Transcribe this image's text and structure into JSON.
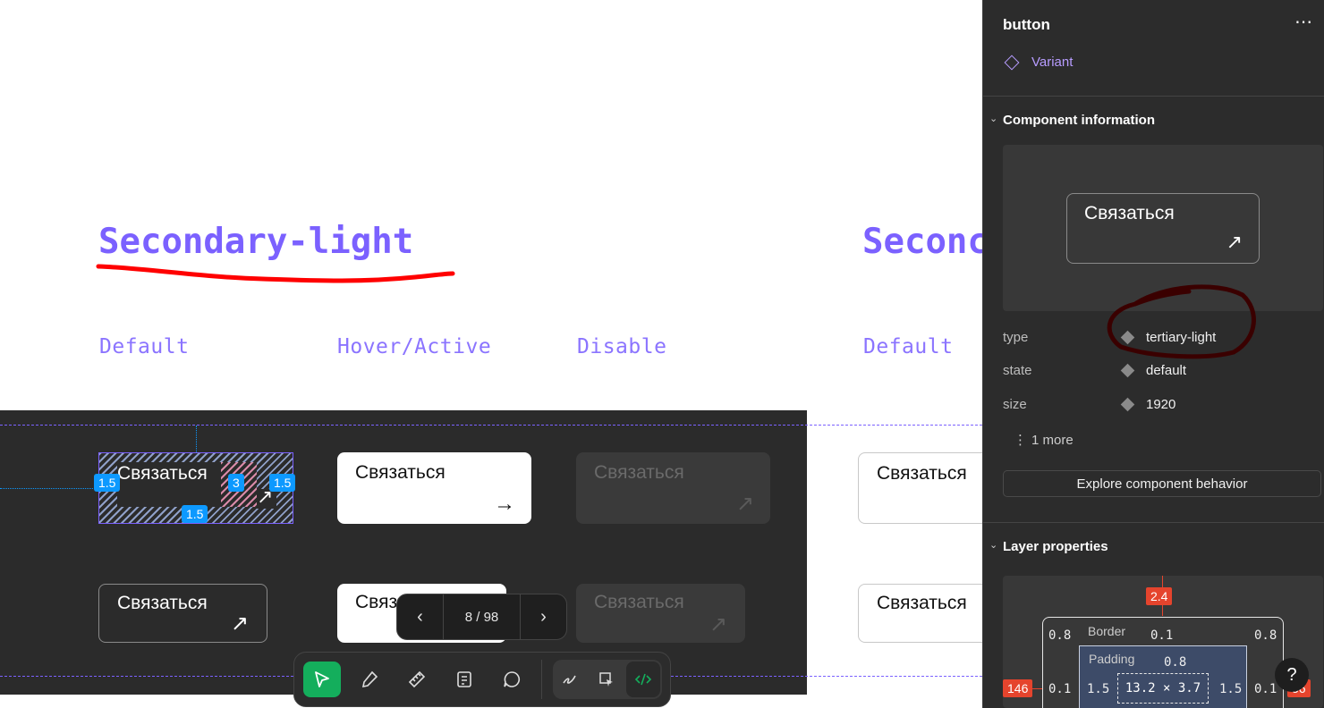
{
  "canvas": {
    "title_left": "Secondary-light",
    "title_right": "Seconc",
    "col_default": "Default",
    "col_hover": "Hover/Active",
    "col_disable": "Disable",
    "col_default_right": "Default",
    "button_label": "Связаться",
    "spacing": {
      "left": "1.5",
      "gap": "3",
      "right": "1.5",
      "bottom": "1.5"
    }
  },
  "pager": {
    "current": "8 / 98"
  },
  "toolbar": {
    "tools": [
      "move-tool",
      "eyedropper-tool",
      "measure-tool",
      "annotate-tool",
      "comment-tool",
      "draw-tool",
      "inspect-tool",
      "code-tool"
    ]
  },
  "panel": {
    "title": "button",
    "variant_label": "Variant",
    "section_component": "Component information",
    "preview_label": "Связаться",
    "props": [
      {
        "key": "type",
        "value": "tertiary-light"
      },
      {
        "key": "state",
        "value": "default"
      },
      {
        "key": "size",
        "value": "1920"
      }
    ],
    "more_label": "1 more",
    "explore_label": "Explore component behavior",
    "section_layer": "Layer properties",
    "box": {
      "margin_top": "2.4",
      "margin_left": "146",
      "margin_right": "56",
      "border_label": "Border",
      "border_top": "0.1",
      "border_left": "0.1",
      "border_right": "0.1",
      "radius_tl": "0.8",
      "radius_tr": "0.8",
      "padding_label": "Padding",
      "padding_top": "0.8",
      "padding_left": "1.5",
      "padding_right": "1.5",
      "size": "13.2 × 3.7"
    },
    "help": "?"
  },
  "colors": {
    "accent": "#7b61ff",
    "panel_bg": "#2c2c2c",
    "canvas_dark": "#2b2b2b",
    "spacing_blue": "#0d99ff",
    "margin_red": "#e5442d",
    "active_tool": "#14ae5c",
    "annotation_red": "#ff0000",
    "annotation_maroon": "#3a0000"
  }
}
